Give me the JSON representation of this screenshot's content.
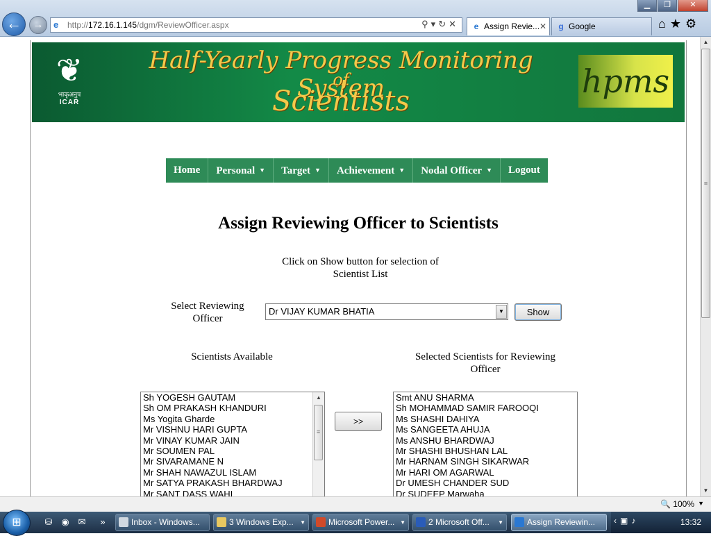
{
  "browser": {
    "url_prefix": "http://",
    "url_host": "172.16.1.145",
    "url_path": "/dgm/ReviewOfficer.aspx",
    "tabs": [
      {
        "label": "Assign Revie...",
        "icon": "ie-icon"
      },
      {
        "label": "Google",
        "icon": "google-icon"
      }
    ]
  },
  "banner": {
    "logo_text_hindi": "भाकृअनुप",
    "logo_text": "ICAR",
    "title_line1": "Half-Yearly Progress Monitoring System",
    "title_line2": "of",
    "title_line3": "Scientists",
    "badge_text": "hpms"
  },
  "menu": [
    {
      "label": "Home",
      "has_dropdown": false
    },
    {
      "label": "Personal",
      "has_dropdown": true
    },
    {
      "label": "Target",
      "has_dropdown": true
    },
    {
      "label": "Achievement",
      "has_dropdown": true
    },
    {
      "label": "Nodal Officer",
      "has_dropdown": true
    },
    {
      "label": "Logout",
      "has_dropdown": false
    }
  ],
  "page": {
    "title": "Assign Reviewing Officer to Scientists",
    "instruction": "Click on Show button for selection of Scientist List",
    "select_label": "Select Reviewing Officer",
    "selected_officer": "Dr VIJAY KUMAR BHATIA",
    "show_button": "Show",
    "available_label": "Scientists Available",
    "selected_label": "Selected Scientists for Reviewing Officer",
    "move_button": ">>",
    "available_scientists": [
      "Sh YOGESH GAUTAM",
      "Sh OM PRAKASH KHANDURI",
      "Ms Yogita Gharde",
      "Mr VISHNU HARI GUPTA",
      "Mr VINAY KUMAR JAIN",
      "Mr SOUMEN PAL",
      "Mr SIVARAMANE N",
      "Mr SHAH NAWAZUL ISLAM",
      "Mr SATYA PRAKASH BHARDWAJ",
      "Mr SANT DASS WAHI"
    ],
    "selected_scientists": [
      "Smt ANU SHARMA",
      "Sh MOHAMMAD SAMIR FAROOQI",
      "Ms SHASHI DAHIYA",
      "Ms SANGEETA AHUJA",
      "Ms ANSHU BHARDWAJ",
      "Mr SHASHI BHUSHAN LAL",
      "Mr HARNAM SINGH SIKARWAR",
      "Mr HARI OM AGARWAL",
      "Dr UMESH CHANDER SUD",
      "Dr SUDEEP Marwaha"
    ]
  },
  "statusbar": {
    "zoom": "100%"
  },
  "taskbar": {
    "tasks": [
      {
        "label": "Inbox - Windows...",
        "icon": "mail-icon",
        "color": "#d0d8e0"
      },
      {
        "label": "3 Windows Exp...",
        "icon": "folder-icon",
        "color": "#e8c860"
      },
      {
        "label": "Microsoft Power...",
        "icon": "powerpoint-icon",
        "color": "#d04a2a"
      },
      {
        "label": "2 Microsoft Off...",
        "icon": "word-icon",
        "color": "#2a5cb8"
      },
      {
        "label": "Assign Reviewin...",
        "icon": "ie-icon",
        "color": "#2a78d2"
      }
    ],
    "clock": "13:32"
  },
  "colors": {
    "menu_bg": "#2e8b57",
    "banner_bg": "#138a47",
    "banner_text": "#f4c94a"
  }
}
